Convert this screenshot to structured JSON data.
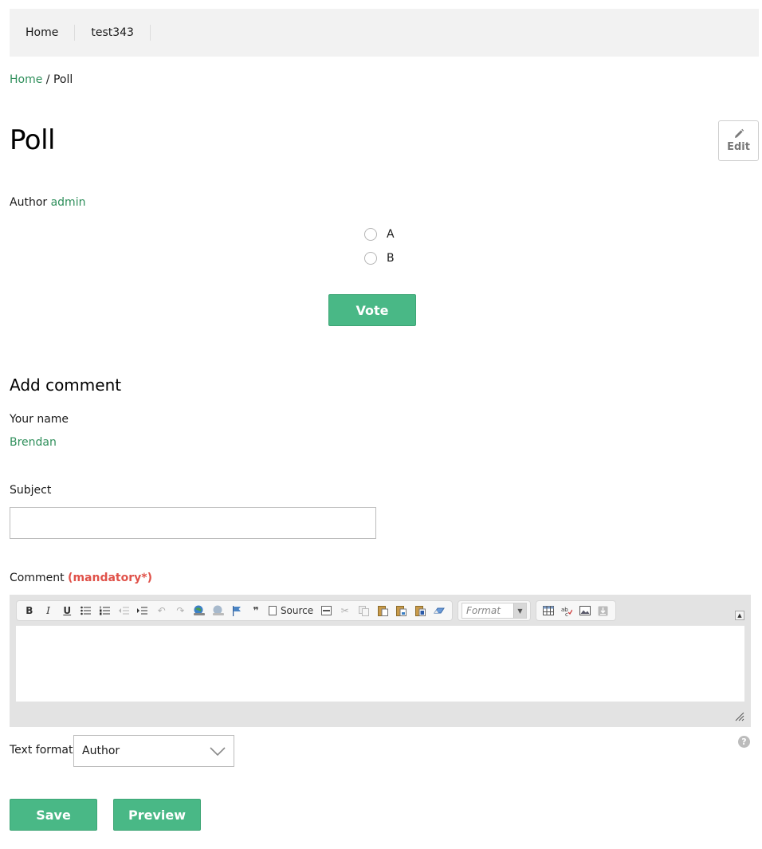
{
  "nav": {
    "items": [
      {
        "label": "Home"
      },
      {
        "label": "test343"
      }
    ]
  },
  "breadcrumb": {
    "home": "Home",
    "separator": " / ",
    "current": "Poll"
  },
  "page": {
    "title": "Poll",
    "edit_label": "Edit"
  },
  "author": {
    "prefix": "Author",
    "name": "admin"
  },
  "poll": {
    "choices": [
      {
        "label": "A",
        "selected": false
      },
      {
        "label": "B",
        "selected": false
      }
    ],
    "vote_label": "Vote"
  },
  "comment_form": {
    "title": "Add comment",
    "your_name_label": "Your name",
    "your_name_value": "Brendan",
    "subject_label": "Subject",
    "subject_value": "",
    "comment_label": "Comment",
    "mandatory_label": "(mandatory*)",
    "editor": {
      "source_label": "Source",
      "format_placeholder": "Format"
    },
    "text_format_label": "Text format",
    "text_format_value": "Author",
    "save_label": "Save",
    "preview_label": "Preview"
  },
  "colors": {
    "accent_green": "#49b886",
    "link_green": "#2f8f5b",
    "mandatory_red": "#e0524a"
  }
}
